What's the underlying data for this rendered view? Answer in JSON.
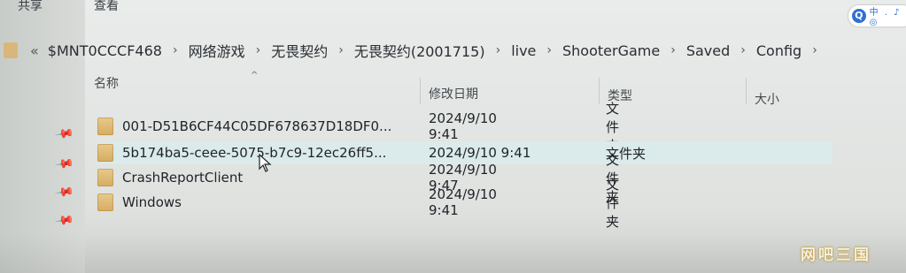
{
  "toolbar": {
    "share_label": "共享",
    "view_label": "查看"
  },
  "ime": {
    "icon": "search-icon",
    "label": "中 . ♪ ◎"
  },
  "address_bar": {
    "overflow": "«",
    "crumbs": [
      "$MNT0CCCF468",
      "网络游戏",
      "无畏契约",
      "无畏契约(2001715)",
      "live",
      "ShooterGame",
      "Saved",
      "Config"
    ]
  },
  "columns": {
    "name": "名称",
    "modified": "修改日期",
    "type": "类型",
    "size": "大小"
  },
  "files": [
    {
      "name": "001-D51B6CF44C05DF678637D18DF0...",
      "modified": "2024/9/10 9:41",
      "type": "文件夹"
    },
    {
      "name": "5b174ba5-ceee-5075-b7c9-12ec26ff5...",
      "modified": "2024/9/10 9:41",
      "type": "文件夹"
    },
    {
      "name": "CrashReportClient",
      "modified": "2024/9/10 9:47",
      "type": "文件夹"
    },
    {
      "name": "Windows",
      "modified": "2024/9/10 9:41",
      "type": "文件夹"
    }
  ],
  "watermark": "网吧三国",
  "colors": {
    "folder": "#d9b679",
    "selection": "#dbeaea"
  }
}
